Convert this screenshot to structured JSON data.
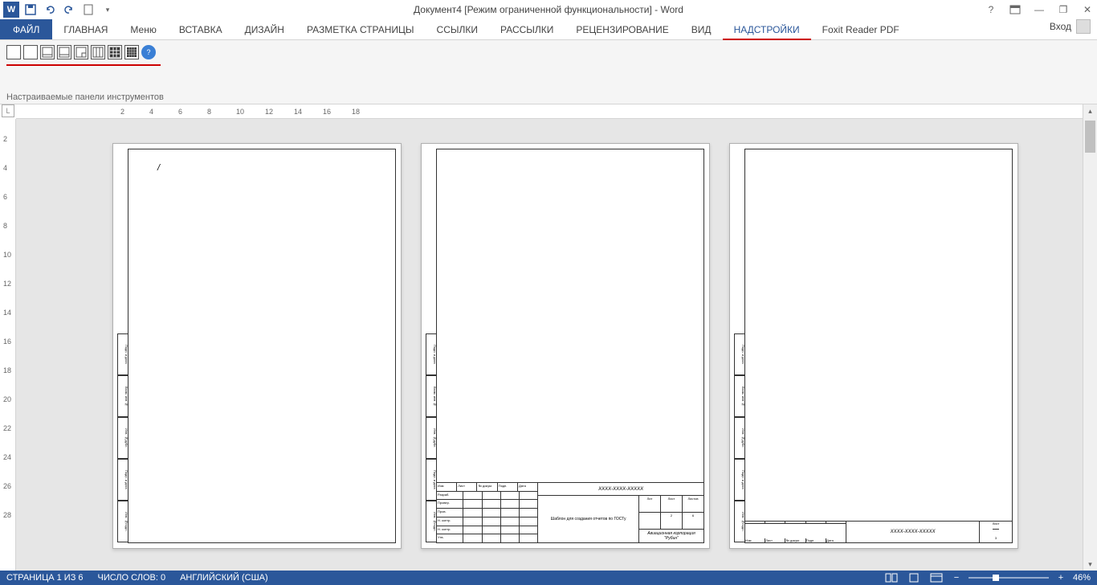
{
  "title": "Документ4 [Режим ограниченной функциональности] - Word",
  "qat": {
    "save": "",
    "undo": "",
    "redo": "",
    "new": ""
  },
  "window": {
    "help": "?",
    "ribbon_opts": "▭",
    "min": "—",
    "restore": "❐",
    "close": "✕"
  },
  "tabs": {
    "file": "ФАЙЛ",
    "home": "ГЛАВНАЯ",
    "menu": "Меню",
    "insert": "ВСТАВКА",
    "design": "ДИЗАЙН",
    "layout": "РАЗМЕТКА СТРАНИЦЫ",
    "references": "ССЫЛКИ",
    "mailings": "РАССЫЛКИ",
    "review": "РЕЦЕНЗИРОВАНИЕ",
    "view": "ВИД",
    "addins": "НАДСТРОЙКИ",
    "foxit": "Foxit Reader PDF"
  },
  "signin": "Вход",
  "ribbon_group": "Настраиваемые панели инструментов",
  "ruler_h": [
    "2",
    "4",
    "6",
    "8",
    "10",
    "12",
    "14",
    "16",
    "18"
  ],
  "ruler_v": [
    "2",
    "4",
    "6",
    "8",
    "10",
    "12",
    "14",
    "16",
    "18",
    "20",
    "22",
    "24",
    "26",
    "28"
  ],
  "gost": {
    "doc_num": "ХХХХ-ХХХХ-ХХХХХ",
    "template": "Шаблон для создания отчетов по ГОСТу",
    "company": "Авиационная корпорация \"Рубин\"",
    "headers": [
      "Лит",
      "Лист",
      "Листов"
    ],
    "values": [
      "",
      "2",
      "6"
    ],
    "sheet_label": "Лист",
    "sheet_num": "3",
    "side_labels": [
      "Подп. и дата",
      "Взам. инв №",
      "Инв. №дубл.",
      "Подп. и дата",
      "Инв. №подл."
    ],
    "row_labels": [
      "Изм",
      "Лист",
      "№ докум.",
      "Подп.",
      "Дата"
    ],
    "roles": [
      "Разраб.",
      "Провер.",
      "Пров.",
      "Н. контр.",
      "Н. контр.",
      "Утв."
    ]
  },
  "status": {
    "page": "СТРАНИЦА 1 ИЗ 6",
    "words": "ЧИСЛО СЛОВ: 0",
    "lang": "АНГЛИЙСКИЙ (США)",
    "zoom": "46%"
  },
  "cursor": "/"
}
